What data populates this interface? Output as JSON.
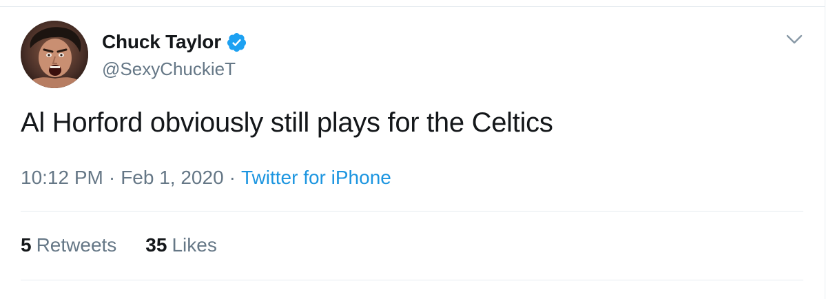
{
  "tweet": {
    "author": {
      "display_name": "Chuck Taylor",
      "handle": "@SexyChuckieT",
      "verified": true,
      "avatar_icon": "profile-photo"
    },
    "text": "Al Horford obviously still plays for the Celtics",
    "time": "10:12 PM",
    "separator": "·",
    "date": "Feb 1, 2020",
    "source": "Twitter for iPhone",
    "stats": {
      "retweets_count": "5",
      "retweets_label": "Retweets",
      "likes_count": "35",
      "likes_label": "Likes"
    },
    "menu_icon": "chevron-down-icon"
  },
  "colors": {
    "text_primary": "#14171a",
    "text_secondary": "#657786",
    "link": "#1b95e0",
    "verified": "#1da1f2",
    "divider": "#e6ecf0"
  }
}
